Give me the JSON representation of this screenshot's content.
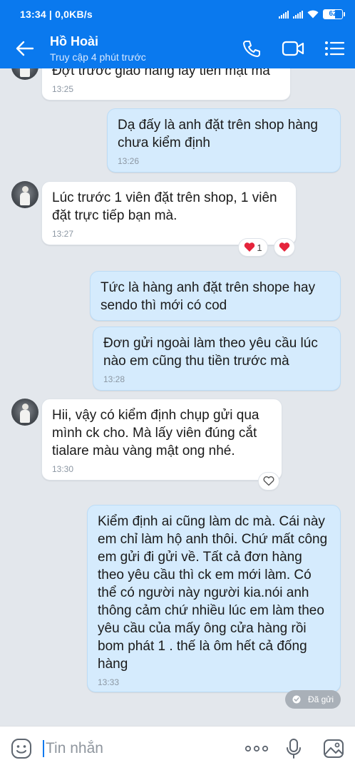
{
  "status_bar": {
    "time_net": "13:34 | 0,0KB/s",
    "battery": "62",
    "battery_level": 0.62
  },
  "header": {
    "name": "Hồ Hoài",
    "subtitle": "Truy cập 4 phút trước"
  },
  "messages": [
    {
      "text": "Đợt trước giao hàng lấy tiền mặt mà",
      "time": "13:25"
    },
    {
      "text": "Dạ đấy là anh đặt trên shop hàng chưa kiểm định",
      "time": "13:26"
    },
    {
      "text": "Lúc trước 1 viên đặt trên shop, 1 viên đặt trực tiếp bạn mà.",
      "time": "13:27"
    },
    {
      "text": "Tức  là hàng anh đặt trên shope hay sendo thì mới có cod",
      "time": ""
    },
    {
      "text": "Đơn gửi ngoài làm theo yêu cầu lúc nào em cũng thu tiền trước mà",
      "time": "13:28"
    },
    {
      "text": "Hii, vậy có kiểm định chụp gửi qua mình ck cho. Mà lấy viên đúng cắt tialare màu vàng mật ong nhé.",
      "time": "13:30"
    },
    {
      "text": "Kiểm định ai cũng làm dc mà. Cái này em chỉ làm hộ anh thôi. Chứ mất công em gửi đi gửi về. Tất cả đơn hàng theo yêu cầu thì ck em mới làm. Có thể có người này người kia.nói anh thông cảm chứ nhiều lúc em làm theo yêu cầu của mấy ông cửa hàng rồi bom phát 1 . thế là ôm hết cả đống hàng",
      "time": "13:33"
    }
  ],
  "reactions": {
    "heart_count": "1"
  },
  "sent_status": "Đã gửi",
  "composer": {
    "placeholder": "Tin nhắn"
  },
  "colors": {
    "brand": "#0a79ee",
    "outgoing": "#d5ebfd",
    "incoming": "#ffffff",
    "background": "#e3e7ec",
    "heart": "#e5243b"
  },
  "icons": [
    "back-arrow-icon",
    "phone-icon",
    "video-call-icon",
    "menu-list-icon",
    "heart-icon",
    "double-check-icon",
    "emoji-icon",
    "more-icon",
    "microphone-icon",
    "image-icon"
  ]
}
